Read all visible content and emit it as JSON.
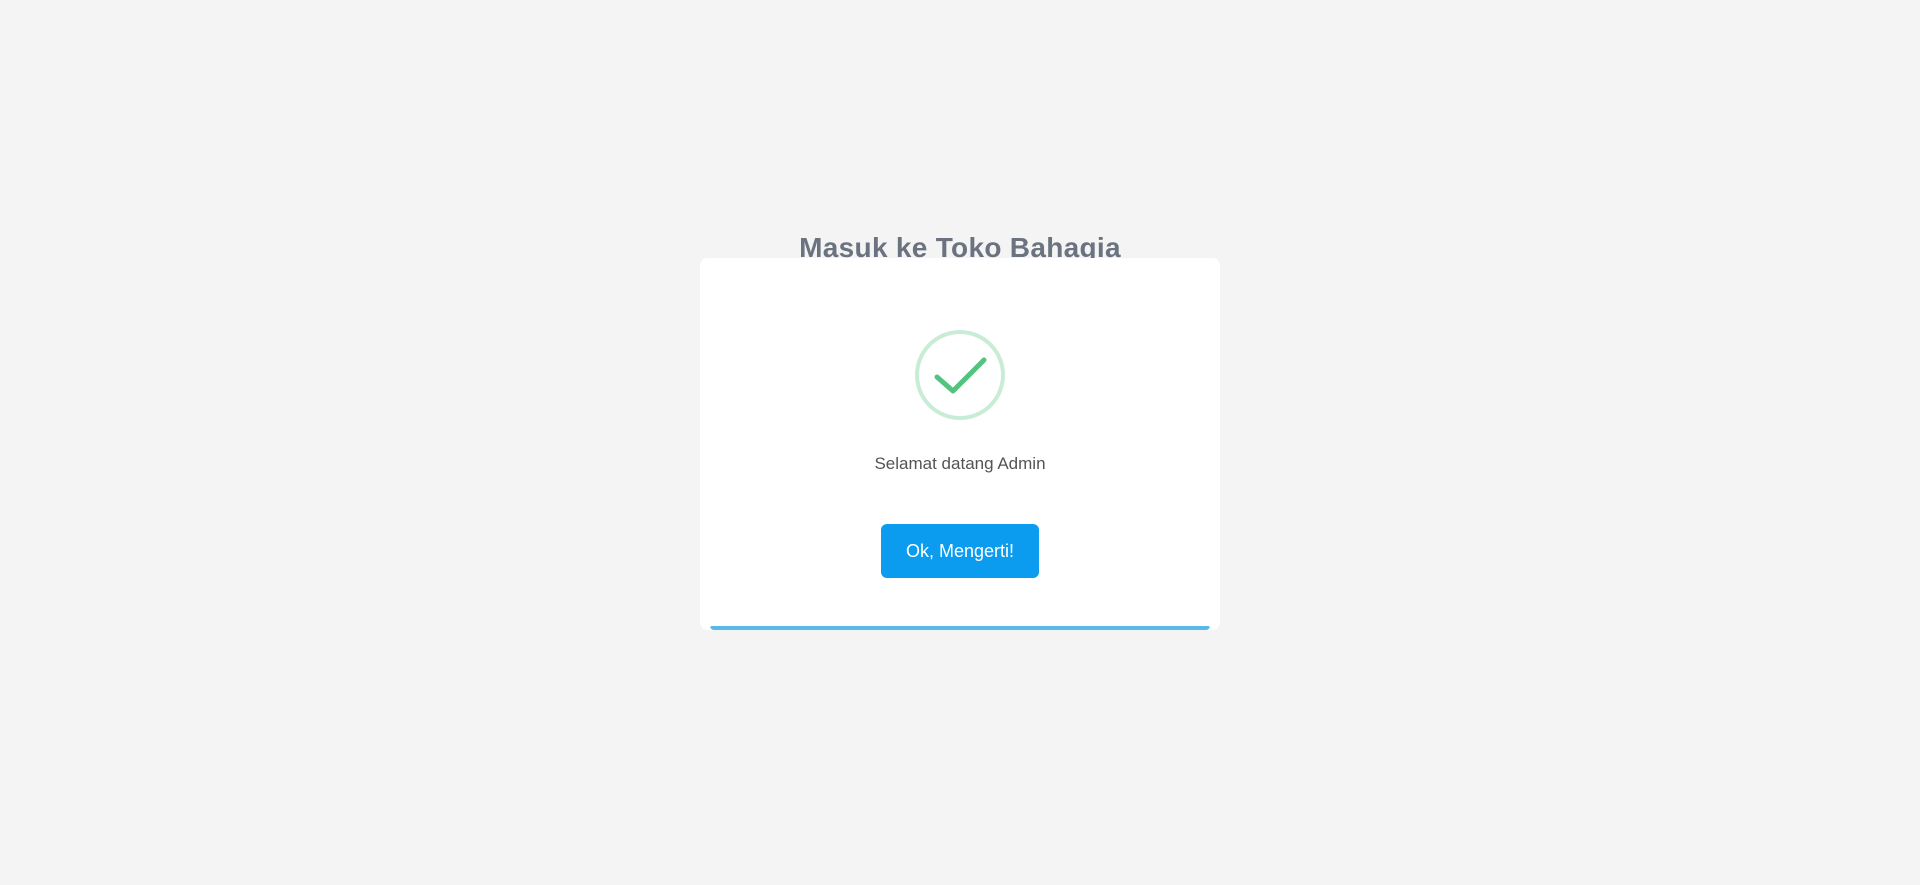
{
  "page": {
    "title": "Masuk ke Toko Bahagia"
  },
  "dialog": {
    "icon": "success-check-icon",
    "message": "Selamat datang Admin",
    "confirm_label": "Ok, Mengerti!",
    "timer_progress": 1.0
  },
  "colors": {
    "background": "#f4f4f4",
    "title": "#6b7280",
    "success_ring": "#c9ecd6",
    "success_check": "#52c47f",
    "button": "#0b9cf0",
    "progress": "#59b9e8"
  }
}
